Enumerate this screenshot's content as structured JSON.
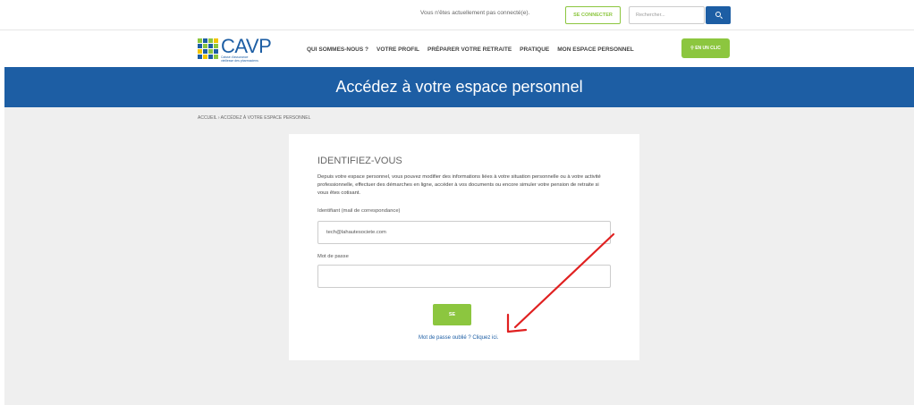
{
  "topbar": {
    "status_text": "Vous n'êtes actuellement pas connecté(e).",
    "login_label": "SE CONNECTER",
    "search_placeholder": "Rechercher...",
    "search_icon": "search-icon"
  },
  "logo": {
    "wordmark": "CAVP",
    "tagline": "Caisse d'assurance vieillesse des pharmaciens"
  },
  "nav": {
    "items": [
      "QUI SOMMES-NOUS ?",
      "VOTRE PROFIL",
      "PRÉPARER VOTRE RETRAITE",
      "PRATIQUE",
      "MON ESPACE PERSONNEL"
    ],
    "cta_label": "EN UN CLIC"
  },
  "hero": {
    "title": "Accédez à votre espace personnel"
  },
  "breadcrumb": "ACCUEIL  ›  ACCÉDEZ À VOTRE ESPACE PERSONNEL",
  "login_card": {
    "title": "IDENTIFIEZ-VOUS",
    "intro": "Depuis votre espace personnel, vous pouvez modifier des informations liées à votre situation personnelle ou à votre activité professionnelle, effectuer des démarches en ligne, accéder à vos documents ou encore simuler votre pension de retraite si vous êtes cotisant.",
    "identifier_label": "Identifiant (mail de correspondance)",
    "identifier_value": "tech@lahautesociete.com",
    "password_label": "Mot de passe",
    "password_value": "",
    "submit_label": "SE CONNECTER",
    "forgot_link": "Mot de passe oublié ? Cliquez ici."
  },
  "colors": {
    "brand_blue": "#1d5ea4",
    "accent_green": "#8cc63f",
    "annotation_red": "#e02020"
  }
}
